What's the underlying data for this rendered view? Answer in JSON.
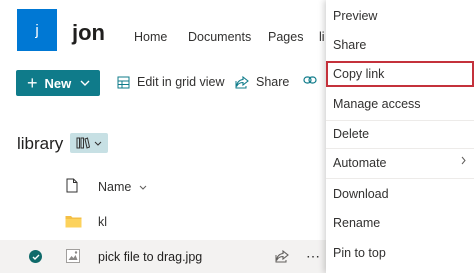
{
  "site": {
    "logo_letter": "j",
    "title": "jon"
  },
  "nav": {
    "items": [
      "Home",
      "Documents",
      "Pages",
      "li"
    ]
  },
  "commandbar": {
    "new_label": "New",
    "grid_view_label": "Edit in grid view",
    "share_label": "Share"
  },
  "library": {
    "title": "library",
    "column_name": "Name",
    "rows": [
      {
        "name": "kl",
        "type": "folder"
      },
      {
        "name": "pick file to drag.jpg",
        "type": "image",
        "selected": true
      }
    ]
  },
  "context_menu": {
    "items": [
      {
        "label": "Preview"
      },
      {
        "label": "Share"
      },
      {
        "label": "Copy link",
        "highlighted": true
      },
      {
        "label": "Manage access"
      },
      {
        "label": "Delete"
      },
      {
        "label": "Automate",
        "submenu": true
      },
      {
        "label": "Download"
      },
      {
        "label": "Rename"
      },
      {
        "label": "Pin to top"
      }
    ]
  },
  "colors": {
    "accent": "#0f7b8a",
    "brand": "#0078d4",
    "highlight_border": "#c4313b"
  }
}
